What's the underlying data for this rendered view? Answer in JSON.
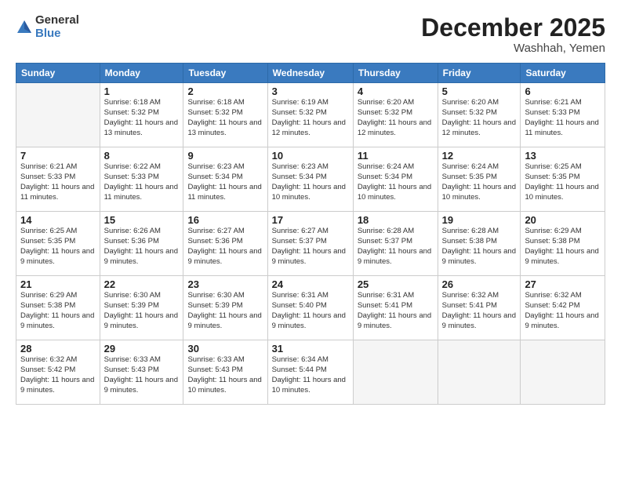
{
  "logo": {
    "general": "General",
    "blue": "Blue"
  },
  "title": "December 2025",
  "location": "Washhah, Yemen",
  "days_header": [
    "Sunday",
    "Monday",
    "Tuesday",
    "Wednesday",
    "Thursday",
    "Friday",
    "Saturday"
  ],
  "weeks": [
    [
      {
        "day": "",
        "sunrise": "",
        "sunset": "",
        "daylight": ""
      },
      {
        "day": "1",
        "sunrise": "Sunrise: 6:18 AM",
        "sunset": "Sunset: 5:32 PM",
        "daylight": "Daylight: 11 hours and 13 minutes."
      },
      {
        "day": "2",
        "sunrise": "Sunrise: 6:18 AM",
        "sunset": "Sunset: 5:32 PM",
        "daylight": "Daylight: 11 hours and 13 minutes."
      },
      {
        "day": "3",
        "sunrise": "Sunrise: 6:19 AM",
        "sunset": "Sunset: 5:32 PM",
        "daylight": "Daylight: 11 hours and 12 minutes."
      },
      {
        "day": "4",
        "sunrise": "Sunrise: 6:20 AM",
        "sunset": "Sunset: 5:32 PM",
        "daylight": "Daylight: 11 hours and 12 minutes."
      },
      {
        "day": "5",
        "sunrise": "Sunrise: 6:20 AM",
        "sunset": "Sunset: 5:32 PM",
        "daylight": "Daylight: 11 hours and 12 minutes."
      },
      {
        "day": "6",
        "sunrise": "Sunrise: 6:21 AM",
        "sunset": "Sunset: 5:33 PM",
        "daylight": "Daylight: 11 hours and 11 minutes."
      }
    ],
    [
      {
        "day": "7",
        "sunrise": "Sunrise: 6:21 AM",
        "sunset": "Sunset: 5:33 PM",
        "daylight": "Daylight: 11 hours and 11 minutes."
      },
      {
        "day": "8",
        "sunrise": "Sunrise: 6:22 AM",
        "sunset": "Sunset: 5:33 PM",
        "daylight": "Daylight: 11 hours and 11 minutes."
      },
      {
        "day": "9",
        "sunrise": "Sunrise: 6:23 AM",
        "sunset": "Sunset: 5:34 PM",
        "daylight": "Daylight: 11 hours and 11 minutes."
      },
      {
        "day": "10",
        "sunrise": "Sunrise: 6:23 AM",
        "sunset": "Sunset: 5:34 PM",
        "daylight": "Daylight: 11 hours and 10 minutes."
      },
      {
        "day": "11",
        "sunrise": "Sunrise: 6:24 AM",
        "sunset": "Sunset: 5:34 PM",
        "daylight": "Daylight: 11 hours and 10 minutes."
      },
      {
        "day": "12",
        "sunrise": "Sunrise: 6:24 AM",
        "sunset": "Sunset: 5:35 PM",
        "daylight": "Daylight: 11 hours and 10 minutes."
      },
      {
        "day": "13",
        "sunrise": "Sunrise: 6:25 AM",
        "sunset": "Sunset: 5:35 PM",
        "daylight": "Daylight: 11 hours and 10 minutes."
      }
    ],
    [
      {
        "day": "14",
        "sunrise": "Sunrise: 6:25 AM",
        "sunset": "Sunset: 5:35 PM",
        "daylight": "Daylight: 11 hours and 9 minutes."
      },
      {
        "day": "15",
        "sunrise": "Sunrise: 6:26 AM",
        "sunset": "Sunset: 5:36 PM",
        "daylight": "Daylight: 11 hours and 9 minutes."
      },
      {
        "day": "16",
        "sunrise": "Sunrise: 6:27 AM",
        "sunset": "Sunset: 5:36 PM",
        "daylight": "Daylight: 11 hours and 9 minutes."
      },
      {
        "day": "17",
        "sunrise": "Sunrise: 6:27 AM",
        "sunset": "Sunset: 5:37 PM",
        "daylight": "Daylight: 11 hours and 9 minutes."
      },
      {
        "day": "18",
        "sunrise": "Sunrise: 6:28 AM",
        "sunset": "Sunset: 5:37 PM",
        "daylight": "Daylight: 11 hours and 9 minutes."
      },
      {
        "day": "19",
        "sunrise": "Sunrise: 6:28 AM",
        "sunset": "Sunset: 5:38 PM",
        "daylight": "Daylight: 11 hours and 9 minutes."
      },
      {
        "day": "20",
        "sunrise": "Sunrise: 6:29 AM",
        "sunset": "Sunset: 5:38 PM",
        "daylight": "Daylight: 11 hours and 9 minutes."
      }
    ],
    [
      {
        "day": "21",
        "sunrise": "Sunrise: 6:29 AM",
        "sunset": "Sunset: 5:38 PM",
        "daylight": "Daylight: 11 hours and 9 minutes."
      },
      {
        "day": "22",
        "sunrise": "Sunrise: 6:30 AM",
        "sunset": "Sunset: 5:39 PM",
        "daylight": "Daylight: 11 hours and 9 minutes."
      },
      {
        "day": "23",
        "sunrise": "Sunrise: 6:30 AM",
        "sunset": "Sunset: 5:39 PM",
        "daylight": "Daylight: 11 hours and 9 minutes."
      },
      {
        "day": "24",
        "sunrise": "Sunrise: 6:31 AM",
        "sunset": "Sunset: 5:40 PM",
        "daylight": "Daylight: 11 hours and 9 minutes."
      },
      {
        "day": "25",
        "sunrise": "Sunrise: 6:31 AM",
        "sunset": "Sunset: 5:41 PM",
        "daylight": "Daylight: 11 hours and 9 minutes."
      },
      {
        "day": "26",
        "sunrise": "Sunrise: 6:32 AM",
        "sunset": "Sunset: 5:41 PM",
        "daylight": "Daylight: 11 hours and 9 minutes."
      },
      {
        "day": "27",
        "sunrise": "Sunrise: 6:32 AM",
        "sunset": "Sunset: 5:42 PM",
        "daylight": "Daylight: 11 hours and 9 minutes."
      }
    ],
    [
      {
        "day": "28",
        "sunrise": "Sunrise: 6:32 AM",
        "sunset": "Sunset: 5:42 PM",
        "daylight": "Daylight: 11 hours and 9 minutes."
      },
      {
        "day": "29",
        "sunrise": "Sunrise: 6:33 AM",
        "sunset": "Sunset: 5:43 PM",
        "daylight": "Daylight: 11 hours and 9 minutes."
      },
      {
        "day": "30",
        "sunrise": "Sunrise: 6:33 AM",
        "sunset": "Sunset: 5:43 PM",
        "daylight": "Daylight: 11 hours and 10 minutes."
      },
      {
        "day": "31",
        "sunrise": "Sunrise: 6:34 AM",
        "sunset": "Sunset: 5:44 PM",
        "daylight": "Daylight: 11 hours and 10 minutes."
      },
      {
        "day": "",
        "sunrise": "",
        "sunset": "",
        "daylight": ""
      },
      {
        "day": "",
        "sunrise": "",
        "sunset": "",
        "daylight": ""
      },
      {
        "day": "",
        "sunrise": "",
        "sunset": "",
        "daylight": ""
      }
    ]
  ]
}
